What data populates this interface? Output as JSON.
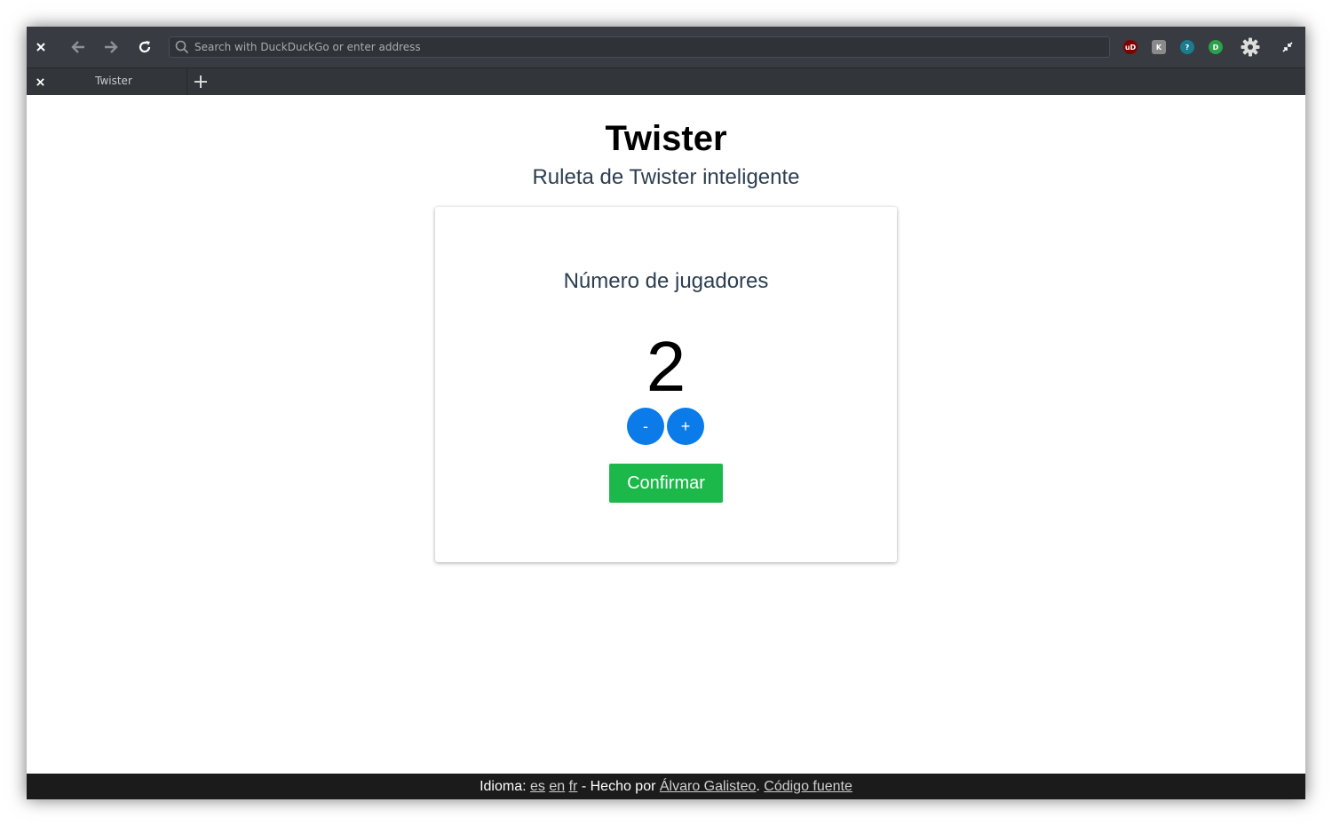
{
  "browser": {
    "url_placeholder": "Search with DuckDuckGo or enter address",
    "tab_title": "Twister",
    "extensions": [
      {
        "name": "ublock-origin",
        "label": "uD",
        "color": "#800000"
      },
      {
        "name": "extension-k",
        "label": "K",
        "color": "#8a8a8a"
      },
      {
        "name": "extension-help",
        "label": "?",
        "color": "#1a7c8e"
      },
      {
        "name": "extension-green",
        "label": "D",
        "color": "#2aa14a"
      }
    ]
  },
  "page": {
    "title": "Twister",
    "subtitle": "Ruleta de Twister inteligente",
    "players_label": "Número de jugadores",
    "players_count": "2",
    "minus_label": "-",
    "plus_label": "+",
    "confirm_label": "Confirmar"
  },
  "footer": {
    "language_prefix": "Idioma: ",
    "languages": [
      "es",
      "en",
      "fr"
    ],
    "made_by_text": " - Hecho por ",
    "author": "Álvaro Galisteo",
    "separator": ". ",
    "source_link": "Código fuente"
  },
  "colors": {
    "primary_button": "#0a7be8",
    "confirm_button": "#1db84a",
    "footer_bg": "#1b1b1b",
    "toolbar_bg": "#383c42"
  }
}
